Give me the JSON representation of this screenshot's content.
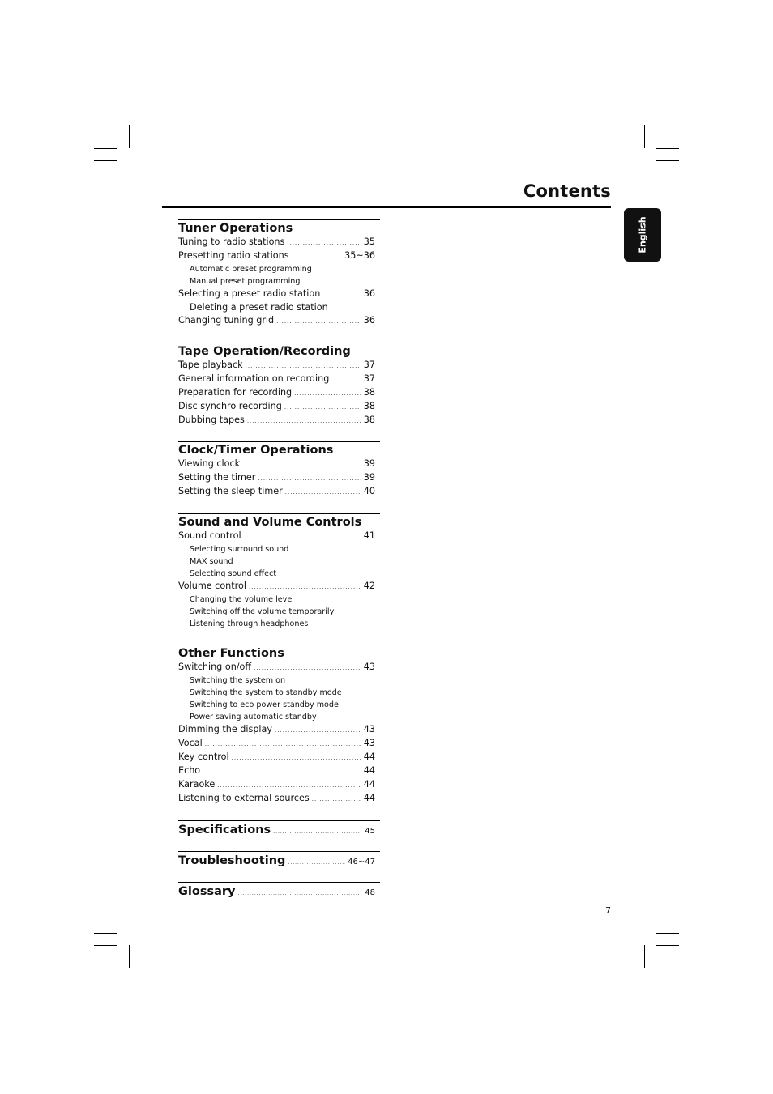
{
  "header": {
    "title": "Contents",
    "language_tab": "English"
  },
  "sections": [
    {
      "heading": "Tuner Operations",
      "entries": [
        {
          "label": "Tuning to radio stations",
          "page": "35"
        },
        {
          "label": "Presetting radio stations",
          "page": "35~36",
          "subs": [
            "Automatic preset programming",
            "Manual preset programming"
          ]
        },
        {
          "label": "Selecting a preset radio station",
          "page": "36",
          "subs_large": [
            "Deleting a preset radio station"
          ]
        },
        {
          "label": "Changing tuning grid",
          "page": "36"
        }
      ]
    },
    {
      "heading": "Tape Operation/Recording",
      "entries": [
        {
          "label": "Tape playback",
          "page": "37"
        },
        {
          "label": "General information on recording",
          "page": "37"
        },
        {
          "label": "Preparation for recording",
          "page": "38"
        },
        {
          "label": "Disc synchro recording",
          "page": "38"
        },
        {
          "label": "Dubbing tapes",
          "page": "38"
        }
      ]
    },
    {
      "heading": "Clock/Timer Operations",
      "entries": [
        {
          "label": "Viewing clock",
          "page": "39"
        },
        {
          "label": "Setting the timer",
          "page": "39"
        },
        {
          "label": "Setting the sleep timer",
          "page": "40"
        }
      ]
    },
    {
      "heading": "Sound and Volume Controls",
      "entries": [
        {
          "label": "Sound control",
          "page": "41",
          "subs": [
            "Selecting surround sound",
            "MAX sound",
            "Selecting sound effect"
          ]
        },
        {
          "label": "Volume control",
          "page": "42",
          "subs": [
            "Changing the volume level",
            "Switching off the volume temporarily",
            "Listening through headphones"
          ]
        }
      ]
    },
    {
      "heading": "Other Functions",
      "entries": [
        {
          "label": "Switching on/off",
          "page": "43",
          "subs": [
            "Switching the system on",
            "Switching the system to standby mode",
            "Switching to eco power standby mode",
            "Power saving automatic standby"
          ]
        },
        {
          "label": "Dimming the display",
          "page": "43"
        },
        {
          "label": "Vocal",
          "page": "43"
        },
        {
          "label": "Key control",
          "page": "44"
        },
        {
          "label": "Echo",
          "page": "44"
        },
        {
          "label": "Karaoke",
          "page": "44"
        },
        {
          "label": "Listening to external sources",
          "page": "44"
        }
      ]
    }
  ],
  "single_sections": [
    {
      "heading": "Specifications",
      "page": "45"
    },
    {
      "heading": "Troubleshooting",
      "page": "46~47"
    },
    {
      "heading": "Glossary",
      "page": "48"
    }
  ],
  "footer": {
    "page_number": "7"
  }
}
